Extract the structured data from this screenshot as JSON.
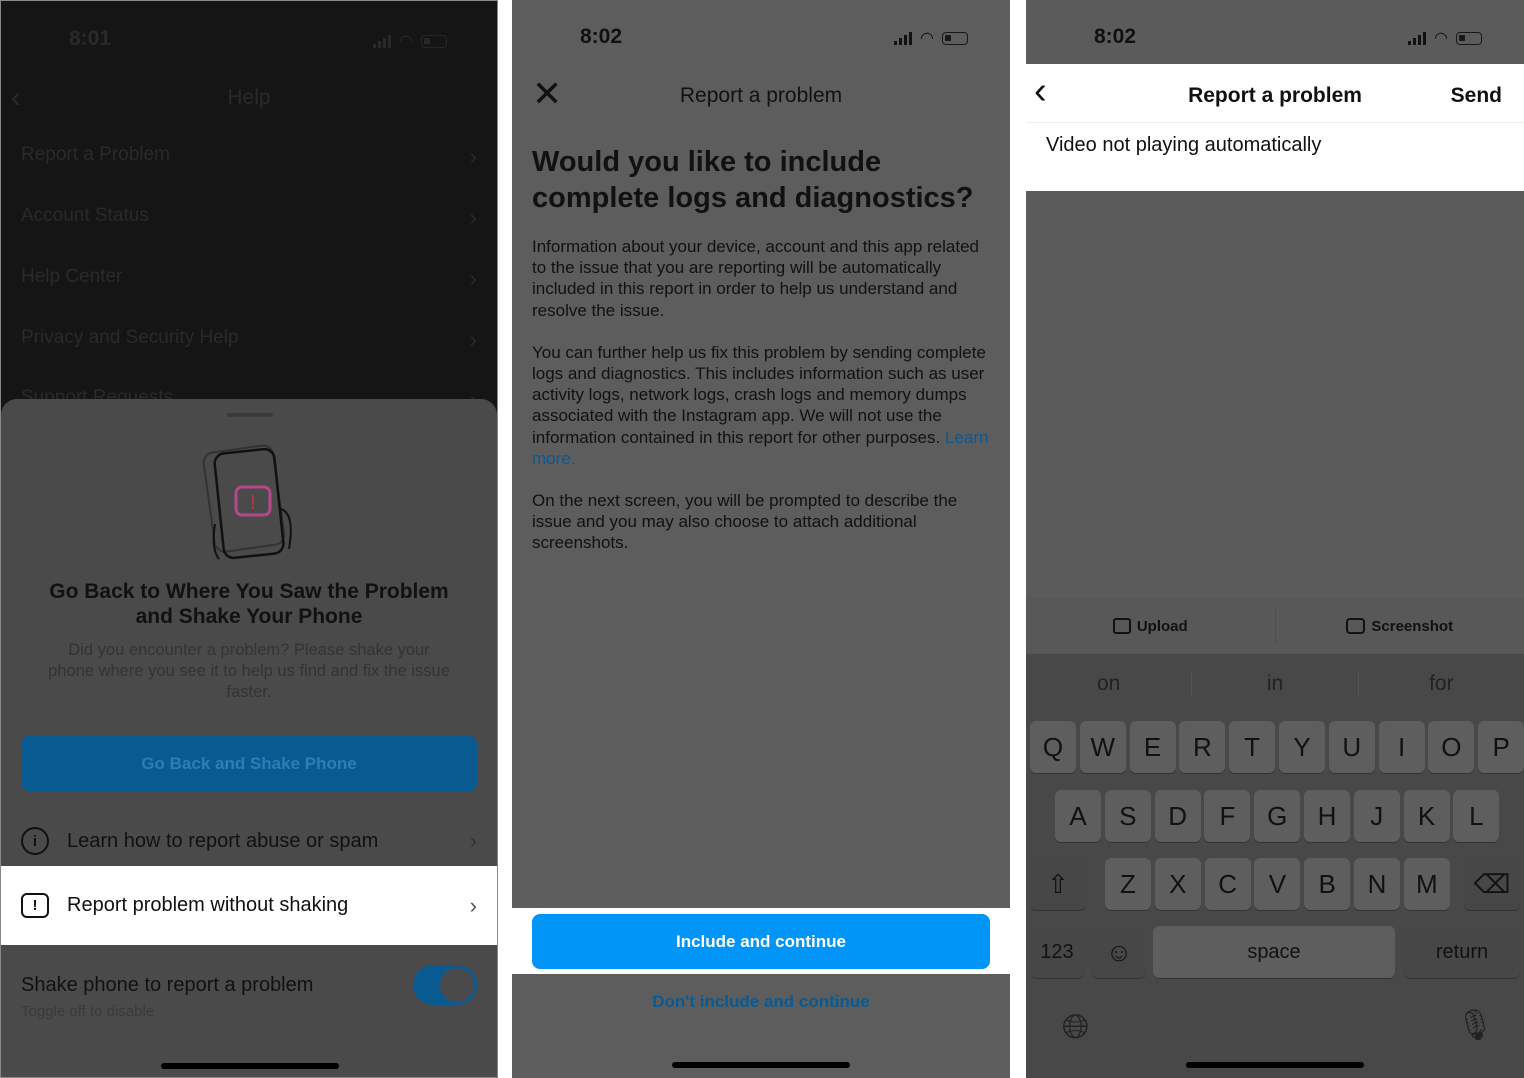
{
  "panel1": {
    "time": "8:01",
    "title": "Help",
    "menu": [
      "Report a Problem",
      "Account Status",
      "Help Center",
      "Privacy and Security Help",
      "Support Requests"
    ],
    "sheet": {
      "heading": "Go Back to Where You Saw the Problem and Shake Your Phone",
      "body": "Did you encounter a problem? Please shake your phone where you see it to help us find and fix the issue faster.",
      "button": "Go Back and Shake Phone",
      "learn": "Learn how to report abuse or spam",
      "report": "Report problem without shaking",
      "shake_title": "Shake phone to report a problem",
      "shake_sub": "Toggle off to disable",
      "toggle_on": true
    }
  },
  "panel2": {
    "time": "8:02",
    "title": "Report a problem",
    "heading": "Would you like to include complete logs and diagnostics?",
    "p1": "Information about your device, account and this app related to the issue that you are reporting will be automatically included in this report in order to help us understand and resolve the issue.",
    "p2": "You can further help us fix this problem by sending complete logs and diagnostics. This includes information such as user activity logs, network logs, crash logs and memory dumps associated with the Instagram app. We will not use the information contained in this report for other purposes.",
    "learn_more": "Learn more.",
    "p3": "On the next screen, you will be prompted to describe the issue and you may also choose to attach additional screenshots.",
    "primary": "Include and continue",
    "secondary": "Don't include and continue"
  },
  "panel3": {
    "time": "8:02",
    "title": "Report a problem",
    "send": "Send",
    "text": "Video not playing automatically",
    "upload": "Upload",
    "screenshot": "Screenshot",
    "suggestions": [
      "on",
      "in",
      "for"
    ],
    "rows": [
      [
        "Q",
        "W",
        "E",
        "R",
        "T",
        "Y",
        "U",
        "I",
        "O",
        "P"
      ],
      [
        "A",
        "S",
        "D",
        "F",
        "G",
        "H",
        "J",
        "K",
        "L"
      ],
      [
        "Z",
        "X",
        "C",
        "V",
        "B",
        "N",
        "M"
      ]
    ],
    "num": "123",
    "space": "space",
    "return": "return"
  },
  "colors": {
    "accent": "#0095f6",
    "dim_accent": "#0a5a92"
  }
}
